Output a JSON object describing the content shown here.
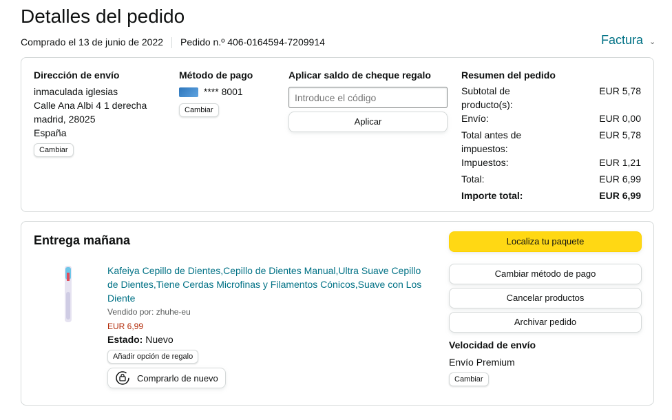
{
  "header": {
    "title": "Detalles del pedido",
    "purchased": "Comprado el 13 de junio de 2022",
    "order_number": "Pedido n.º 406-0164594-7209914",
    "invoice": "Factura"
  },
  "shipping": {
    "heading": "Dirección de envío",
    "lines": [
      "inmaculada iglesias",
      "Calle Ana Albi 4 1 derecha",
      "madrid, 28025",
      "España"
    ],
    "change": "Cambiar"
  },
  "payment": {
    "heading": "Método de pago",
    "card": "**** 8001",
    "card_icon": "amex-card-icon",
    "change": "Cambiar"
  },
  "gift": {
    "heading": "Aplicar saldo de cheque regalo",
    "placeholder": "Introduce el código",
    "apply": "Aplicar"
  },
  "summary": {
    "heading": "Resumen del pedido",
    "rows": [
      {
        "label": "Subtotal de producto(s):",
        "value": "EUR 5,78"
      },
      {
        "label": "Envío:",
        "value": "EUR 0,00"
      },
      {
        "label": "Total antes de impuestos:",
        "value": "EUR 5,78"
      },
      {
        "label": "Impuestos:",
        "value": "EUR 1,21"
      },
      {
        "label": "Total:",
        "value": "EUR 6,99"
      },
      {
        "label": "Importe total:",
        "value": "EUR 6,99"
      }
    ]
  },
  "delivery": {
    "heading": "Entrega mañana",
    "product_title": "Kafeiya Cepillo de Dientes,Cepillo de Dientes Manual,Ultra Suave Cepillo de Dientes,Tiene Cerdas Microfinas y Filamentos Cónicos,Suave con Los Diente",
    "sold_by": "Vendido por: zhuhe-eu",
    "price": "EUR 6,99",
    "state_label": "Estado:",
    "state_value": "Nuevo",
    "gift_option": "Añadir opción de regalo",
    "buy_again": "Comprarlo de nuevo"
  },
  "actions": {
    "track": "Localiza tu paquete",
    "change_payment": "Cambiar método de pago",
    "cancel": "Cancelar productos",
    "archive": "Archivar pedido",
    "speed_heading": "Velocidad de envío",
    "speed_value": "Envío Premium",
    "speed_change": "Cambiar"
  },
  "colors": {
    "link": "#007185",
    "price": "#b12704",
    "yellow_button": "#ffd814"
  }
}
